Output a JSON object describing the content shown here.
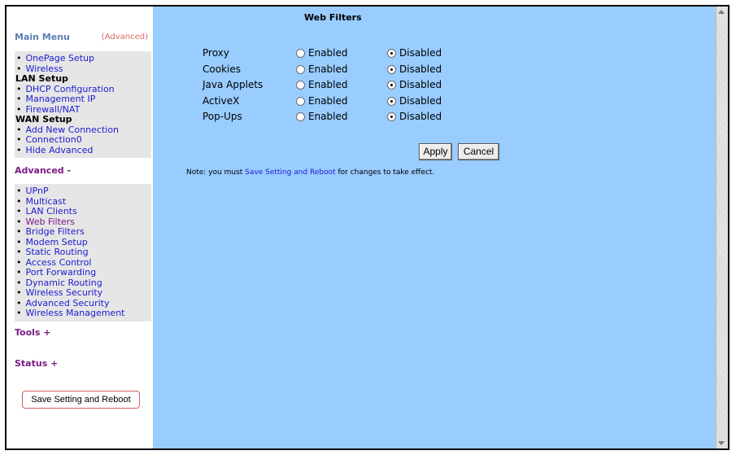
{
  "sidebar": {
    "main_menu_title": "Main Menu",
    "advanced_toggle": "(Advanced)",
    "main_group": [
      {
        "type": "item",
        "label": "OnePage Setup"
      },
      {
        "type": "item",
        "label": "Wireless"
      },
      {
        "type": "head",
        "label": "LAN Setup"
      },
      {
        "type": "item",
        "label": "DHCP Configuration"
      },
      {
        "type": "item",
        "label": "Management IP"
      },
      {
        "type": "item",
        "label": "Firewall/NAT"
      },
      {
        "type": "head",
        "label": "WAN Setup"
      },
      {
        "type": "item",
        "label": "Add New Connection"
      },
      {
        "type": "item",
        "label": "Connection0"
      },
      {
        "type": "item",
        "label": "Hide Advanced"
      }
    ],
    "advanced_title": "Advanced -",
    "advanced_group": [
      "UPnP",
      "Multicast",
      "LAN Clients",
      "Web Filters",
      "Bridge Filters",
      "Modem Setup",
      "Static Routing",
      "Access Control",
      "Port Forwarding",
      "Dynamic Routing",
      "Wireless Security",
      "Advanced Security",
      "Wireless Management"
    ],
    "active_item": "Web Filters",
    "tools_title": "Tools +",
    "status_title": "Status +",
    "save_button": "Save Setting and Reboot"
  },
  "main": {
    "title": "Web Filters",
    "enabled_label": "Enabled",
    "disabled_label": "Disabled",
    "filters": [
      {
        "name": "Proxy",
        "value": "Disabled"
      },
      {
        "name": "Cookies",
        "value": "Disabled"
      },
      {
        "name": "Java Applets",
        "value": "Disabled"
      },
      {
        "name": "ActiveX",
        "value": "Disabled"
      },
      {
        "name": "Pop-Ups",
        "value": "Disabled"
      }
    ],
    "apply_button": "Apply",
    "cancel_button": "Cancel",
    "note_prefix": "Note: you must ",
    "note_link": "Save Setting and Reboot",
    "note_suffix": " for changes to take effect."
  },
  "colors": {
    "content_background": "#99ccff",
    "link": "#1b1bd0",
    "active_link": "#7a1a86",
    "section_heading": "#7a1a86"
  }
}
